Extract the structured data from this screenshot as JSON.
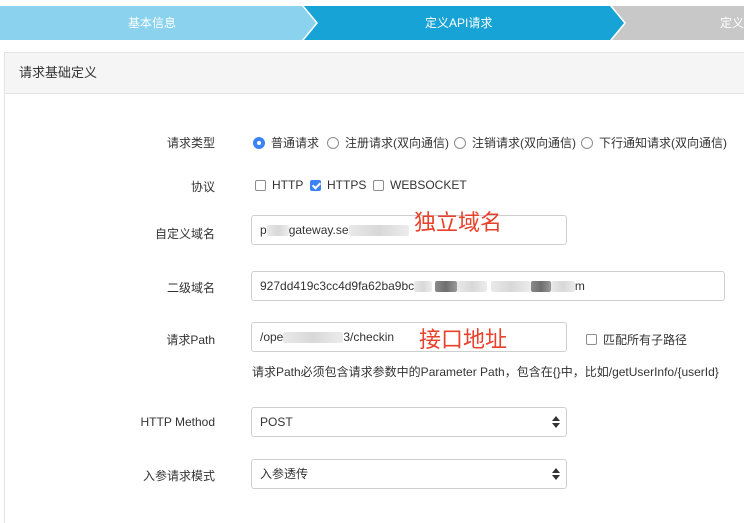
{
  "steps": [
    {
      "label": "基本信息",
      "state": "done"
    },
    {
      "label": "定义API请求",
      "state": "active"
    },
    {
      "label": "定义",
      "state": "pending"
    }
  ],
  "colors": {
    "step_done": "#8ad2ee",
    "step_active": "#17a3d6",
    "step_pending": "#c8c8c8",
    "accent": "#3b82f6",
    "annotation": "#e8412c"
  },
  "section": {
    "title": "请求基础定义"
  },
  "form": {
    "request_type": {
      "label": "请求类型",
      "options": [
        "普通请求",
        "注册请求(双向通信)",
        "注销请求(双向通信)",
        "下行通知请求(双向通信)"
      ],
      "selected": "普通请求"
    },
    "protocol": {
      "label": "协议",
      "options": [
        {
          "label": "HTTP",
          "checked": false
        },
        {
          "label": "HTTPS",
          "checked": true
        },
        {
          "label": "WEBSOCKET",
          "checked": false
        }
      ]
    },
    "custom_domain": {
      "label": "自定义域名",
      "value_prefix": "p",
      "value_mid": "gateway.se"
    },
    "second_domain": {
      "label": "二级域名",
      "value_prefix": "927dd419c3cc4d9fa62ba9bc",
      "value_suffix": "m"
    },
    "request_path": {
      "label": "请求Path",
      "value_prefix": "/ope",
      "value_mid": "3/checkin",
      "match_all_label": "匹配所有子路径",
      "hint": "请求Path必须包含请求参数中的Parameter Path，包含在{}中，比如/getUserInfo/{userId}"
    },
    "http_method": {
      "label": "HTTP Method",
      "value": "POST"
    },
    "param_mode": {
      "label": "入参请求模式",
      "value": "入参透传"
    }
  },
  "annotations": {
    "domain": "独立域名",
    "path": "接口地址"
  }
}
